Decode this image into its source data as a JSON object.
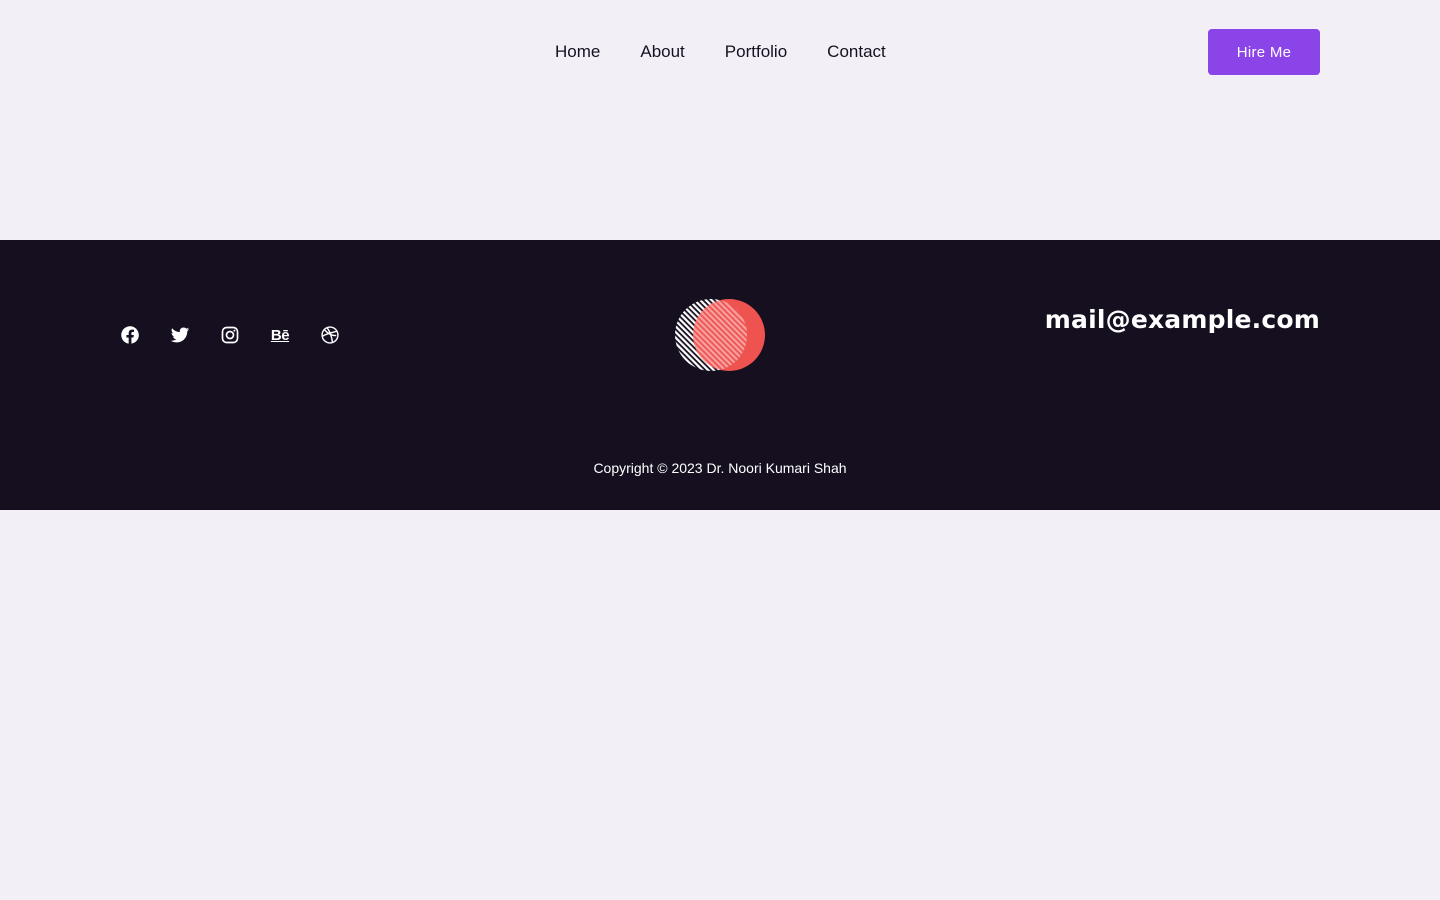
{
  "nav": {
    "items": [
      {
        "label": "Home"
      },
      {
        "label": "About"
      },
      {
        "label": "Portfolio"
      },
      {
        "label": "Contact"
      }
    ],
    "cta_label": "Hire Me"
  },
  "footer": {
    "socials": [
      {
        "icon": "facebook-icon"
      },
      {
        "icon": "twitter-icon"
      },
      {
        "icon": "instagram-icon"
      },
      {
        "icon": "behance-icon",
        "glyph": "Bē"
      },
      {
        "icon": "dribbble-icon"
      }
    ],
    "email": "mail@example.com",
    "copyright": "Copyright © 2023 Dr. Noori Kumari Shah"
  },
  "colors": {
    "page_background": "#f2f0f6",
    "footer_background": "#160f20",
    "accent": "#8a44e8",
    "logo_red": "#ef5350"
  }
}
